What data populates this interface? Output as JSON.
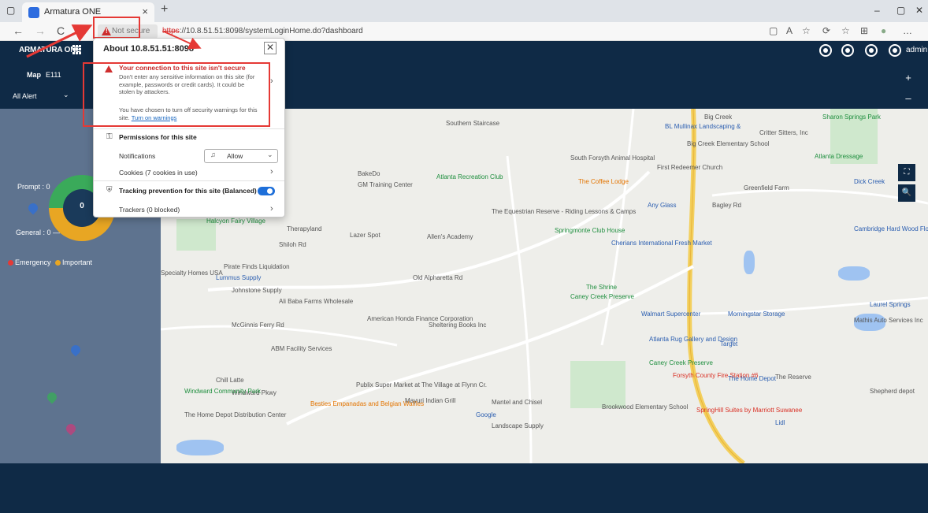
{
  "browser": {
    "tab_title": "Armatura ONE",
    "tab_close": "×",
    "new_tab": "+",
    "not_secure": "Not secure",
    "url_protocol": "https",
    "url_rest": "://10.8.51.51:8098/systemLoginHome.do?dashboard",
    "window": {
      "minimize": "–",
      "maximize": "▢",
      "close": "✕"
    },
    "nav_icons": {
      "back": "←",
      "forward": "→",
      "refresh": "C",
      "home": "⌂"
    },
    "tool_icons": [
      "▢",
      "A",
      "☆",
      "⟳",
      "☆",
      "⊞",
      "●",
      "…"
    ]
  },
  "app": {
    "brand": "ARMATURA ONE",
    "admin_label": "admin",
    "map_label": "Map",
    "map_value": "E111",
    "alert_select": "All Alert",
    "alert_chev": "⌄",
    "zoom_in": "+",
    "zoom_out": "–",
    "map_ctl_expand": "⛶",
    "map_ctl_zoom": "🔍",
    "colors": {
      "navy": "#0f2a46",
      "map_bg": "#eeeeea",
      "alert_red": "#e53935"
    }
  },
  "panel": {
    "donut_value": "0",
    "prompt": "Prompt : 0",
    "general": "General : 0 —",
    "legend": [
      {
        "label": "Emergency",
        "color": "#e53935"
      },
      {
        "label": "Important",
        "color": "#e8a623"
      }
    ]
  },
  "popup": {
    "title": "About 10.8.51.51:8098",
    "close": "✕",
    "warning_title": "Your connection to this site isn't secure",
    "warning_body": "Don't enter any sensitive information on this site (for example, passwords or credit cards). It could be stolen by attackers.",
    "warning_body2_prefix": "You have chosen to turn off security warnings for this site.",
    "warning_link": "Turn on warnings",
    "permissions_head": "Permissions for this site",
    "notifications_label": "Notifications",
    "notifications_value": "Allow",
    "cookies_label": "Cookies (7 cookies in use)",
    "tracking_head": "Tracking prevention for this site (Balanced)",
    "trackers_label": "Trackers (0 blocked)",
    "chevron": "›"
  },
  "map_labels": [
    {
      "text": "Big Creek",
      "cls": ""
    },
    {
      "text": "Southern Staircase",
      "cls": ""
    },
    {
      "text": "BL Mullinax Landscaping &",
      "cls": "blue"
    },
    {
      "text": "Critter Sitters, Inc",
      "cls": ""
    },
    {
      "text": "Big Creek Elementary School",
      "cls": ""
    },
    {
      "text": "Sharon Springs Park",
      "cls": "green"
    },
    {
      "text": "Atlanta Dressage",
      "cls": "green"
    },
    {
      "text": "South Forsyth Animal Hospital",
      "cls": ""
    },
    {
      "text": "First Redeemer Church",
      "cls": ""
    },
    {
      "text": "The Coffee Lodge",
      "cls": "orange"
    },
    {
      "text": "Greenfield Farm",
      "cls": ""
    },
    {
      "text": "BakeDo",
      "cls": ""
    },
    {
      "text": "Atlanta Recreation Club",
      "cls": "green"
    },
    {
      "text": "GM Training Center",
      "cls": ""
    },
    {
      "text": "Any Glass",
      "cls": "blue"
    },
    {
      "text": "Bagley Rd",
      "cls": ""
    },
    {
      "text": "Dick Creek",
      "cls": "blue"
    },
    {
      "text": "The Equestrian Reserve - Riding Lessons & Camps",
      "cls": ""
    },
    {
      "text": "Springmonte Club House",
      "cls": "green"
    },
    {
      "text": "Cambridge Hard Wood Floors",
      "cls": "blue"
    },
    {
      "text": "Halcyon Fairy Village",
      "cls": "green"
    },
    {
      "text": "Therapyland",
      "cls": ""
    },
    {
      "text": "Lazer Spot",
      "cls": ""
    },
    {
      "text": "Allen's Academy",
      "cls": ""
    },
    {
      "text": "Cherians International Fresh Market",
      "cls": "blue"
    },
    {
      "text": "Shiloh Rd",
      "cls": ""
    },
    {
      "text": "Pirate Finds Liquidation",
      "cls": ""
    },
    {
      "text": "Old Alpharetta Rd",
      "cls": ""
    },
    {
      "text": "Specialty Homes USA",
      "cls": ""
    },
    {
      "text": "Lummus Supply",
      "cls": "blue"
    },
    {
      "text": "Johnstone Supply",
      "cls": ""
    },
    {
      "text": "Ali Baba Farms Wholesale",
      "cls": ""
    },
    {
      "text": "The Shrine",
      "cls": "green"
    },
    {
      "text": "Caney Creek Preserve",
      "cls": "green"
    },
    {
      "text": "Walmart Supercenter",
      "cls": "blue"
    },
    {
      "text": "Morningstar Storage",
      "cls": "blue"
    },
    {
      "text": "Laurel Springs",
      "cls": "blue"
    },
    {
      "text": "Mathis Auto Services Inc",
      "cls": ""
    },
    {
      "text": "McGinnis Ferry Rd",
      "cls": ""
    },
    {
      "text": "American Honda Finance Corporation",
      "cls": ""
    },
    {
      "text": "Sheltering Books Inc",
      "cls": ""
    },
    {
      "text": "Atlanta Rug Gallery and Design",
      "cls": "blue"
    },
    {
      "text": "Target",
      "cls": "blue"
    },
    {
      "text": "ABM Facility Services",
      "cls": ""
    },
    {
      "text": "Caney Creek Preserve",
      "cls": "green"
    },
    {
      "text": "Chill Latte",
      "cls": ""
    },
    {
      "text": "Forsyth County Fire Station #6",
      "cls": "red"
    },
    {
      "text": "The Home Depot",
      "cls": "blue"
    },
    {
      "text": "The Reserve",
      "cls": ""
    },
    {
      "text": "Windward Pkwy",
      "cls": ""
    },
    {
      "text": "Publix Super Market at The Village at Flynn Cr.",
      "cls": ""
    },
    {
      "text": "Windward Community Park",
      "cls": "green"
    },
    {
      "text": "Besties Empanadas and Belgian Waffles",
      "cls": "orange"
    },
    {
      "text": "Mayuri Indian Grill",
      "cls": ""
    },
    {
      "text": "Mantel and Chisel",
      "cls": ""
    },
    {
      "text": "Brookwood Elementary School",
      "cls": ""
    },
    {
      "text": "SpringHill Suites by Marriott Suwanee",
      "cls": "red"
    },
    {
      "text": "Lidl",
      "cls": "blue"
    },
    {
      "text": "The Home Depot Distribution Center",
      "cls": ""
    },
    {
      "text": "Google",
      "cls": "blue"
    },
    {
      "text": "Landscape Supply",
      "cls": ""
    },
    {
      "text": "Shepherd depot",
      "cls": ""
    }
  ]
}
